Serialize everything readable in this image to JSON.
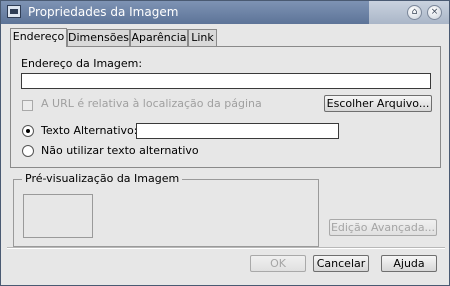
{
  "window": {
    "title": "Propriedades da Imagem",
    "buttons": {
      "shade_icon": "⌂",
      "close_icon": "×"
    }
  },
  "tabs": [
    {
      "label": "Endereço"
    },
    {
      "label": "Dimensões"
    },
    {
      "label": "Aparência"
    },
    {
      "label": "Link"
    }
  ],
  "location": {
    "label": "Endereço da Imagem:",
    "value": "",
    "relative_label": "A URL é relativa à localização da página",
    "choose_file_label": "Escolher Arquivo..."
  },
  "alt_text": {
    "alt_label": "Texto Alternativo:",
    "alt_value": "",
    "no_alt_label": "Não utilizar texto alternativo"
  },
  "preview": {
    "title": "Pré-visualização da Imagem"
  },
  "advanced_label": "Edição Avançada...",
  "footer": {
    "ok_label": "OK",
    "cancel_label": "Cancelar",
    "help_label": "Ajuda"
  }
}
